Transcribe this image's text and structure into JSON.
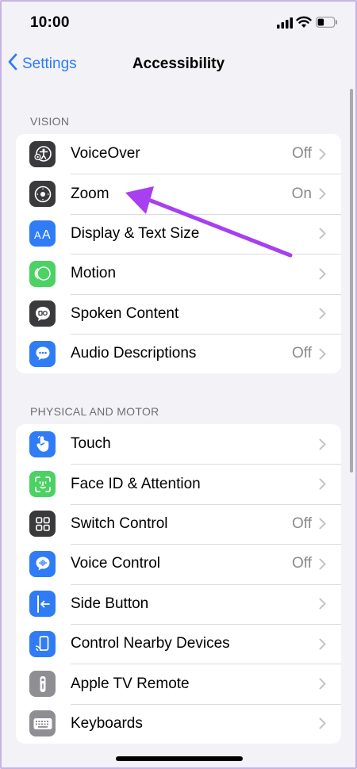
{
  "status": {
    "time": "10:00"
  },
  "nav": {
    "back_label": "Settings",
    "title": "Accessibility"
  },
  "colors": {
    "accent": "#2f7cf6",
    "arrow": "#a640f0"
  },
  "sections": [
    {
      "header": "VISION",
      "items": [
        {
          "label": "VoiceOver",
          "value": "Off",
          "icon": "voiceover-icon"
        },
        {
          "label": "Zoom",
          "value": "On",
          "icon": "zoom-icon"
        },
        {
          "label": "Display & Text Size",
          "value": "",
          "icon": "text-size-icon"
        },
        {
          "label": "Motion",
          "value": "",
          "icon": "motion-icon"
        },
        {
          "label": "Spoken Content",
          "value": "",
          "icon": "spoken-content-icon"
        },
        {
          "label": "Audio Descriptions",
          "value": "Off",
          "icon": "audio-descriptions-icon"
        }
      ]
    },
    {
      "header": "PHYSICAL AND MOTOR",
      "items": [
        {
          "label": "Touch",
          "value": "",
          "icon": "touch-icon"
        },
        {
          "label": "Face ID & Attention",
          "value": "",
          "icon": "face-id-icon"
        },
        {
          "label": "Switch Control",
          "value": "Off",
          "icon": "switch-control-icon"
        },
        {
          "label": "Voice Control",
          "value": "Off",
          "icon": "voice-control-icon"
        },
        {
          "label": "Side Button",
          "value": "",
          "icon": "side-button-icon"
        },
        {
          "label": "Control Nearby Devices",
          "value": "",
          "icon": "nearby-devices-icon"
        },
        {
          "label": "Apple TV Remote",
          "value": "",
          "icon": "tv-remote-icon"
        },
        {
          "label": "Keyboards",
          "value": "",
          "icon": "keyboard-icon"
        }
      ]
    }
  ]
}
